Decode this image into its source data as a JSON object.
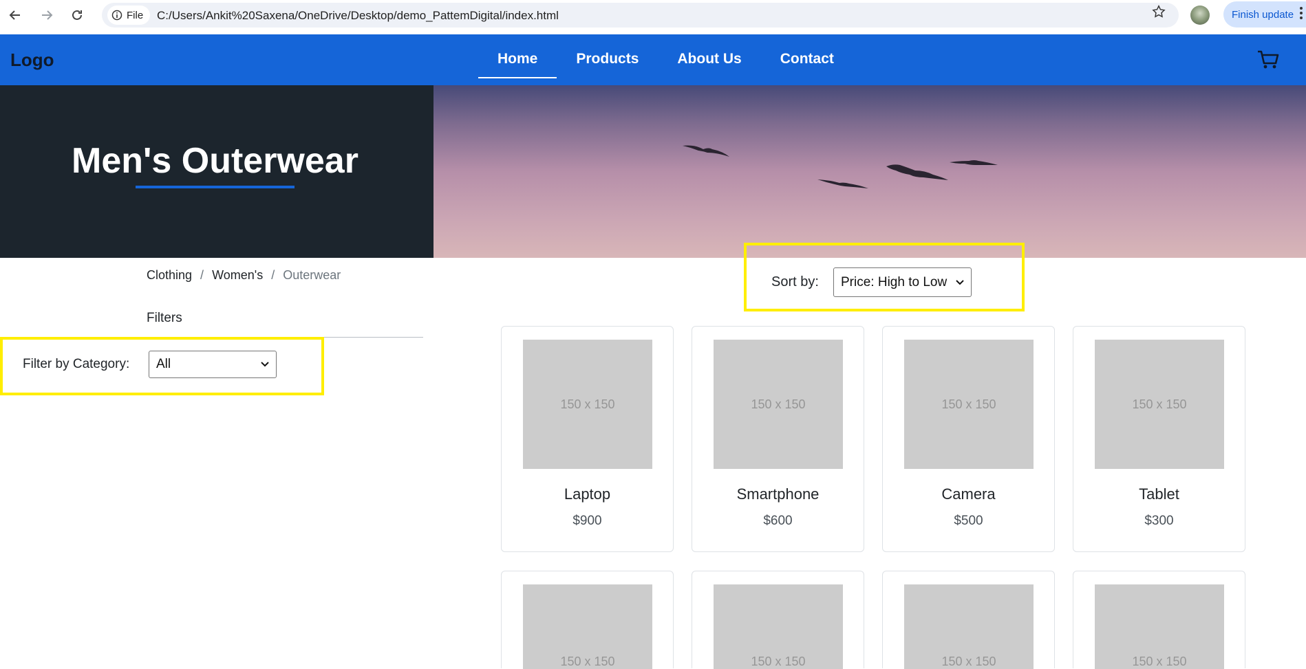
{
  "browser": {
    "file_label": "File",
    "url": "C:/Users/Ankit%20Saxena/OneDrive/Desktop/demo_PattemDigital/index.html",
    "update_label": "Finish update"
  },
  "header": {
    "logo": "Logo",
    "nav": [
      {
        "label": "Home"
      },
      {
        "label": "Products"
      },
      {
        "label": "About Us"
      },
      {
        "label": "Contact"
      }
    ]
  },
  "hero": {
    "title": "Men's Outerwear"
  },
  "breadcrumb": {
    "items": [
      "Clothing",
      "Women's",
      "Outerwear"
    ],
    "separator": "/"
  },
  "filters": {
    "heading": "Filters",
    "category_label": "Filter by Category:",
    "category_value": "All"
  },
  "sort": {
    "label": "Sort by:",
    "value": "Price: High to Low"
  },
  "products": [
    {
      "name": "Laptop",
      "price": "$900",
      "image_text": "150 x 150"
    },
    {
      "name": "Smartphone",
      "price": "$600",
      "image_text": "150 x 150"
    },
    {
      "name": "Camera",
      "price": "$500",
      "image_text": "150 x 150"
    },
    {
      "name": "Tablet",
      "price": "$300",
      "image_text": "150 x 150"
    }
  ],
  "products_row2": [
    {
      "image_text": "150 x 150"
    },
    {
      "image_text": "150 x 150"
    },
    {
      "image_text": "150 x 150"
    },
    {
      "image_text": "150 x 150"
    }
  ],
  "colors": {
    "header_blue": "#1565d8",
    "highlight_yellow": "#ffee00",
    "hero_dark": "#1c252d"
  }
}
